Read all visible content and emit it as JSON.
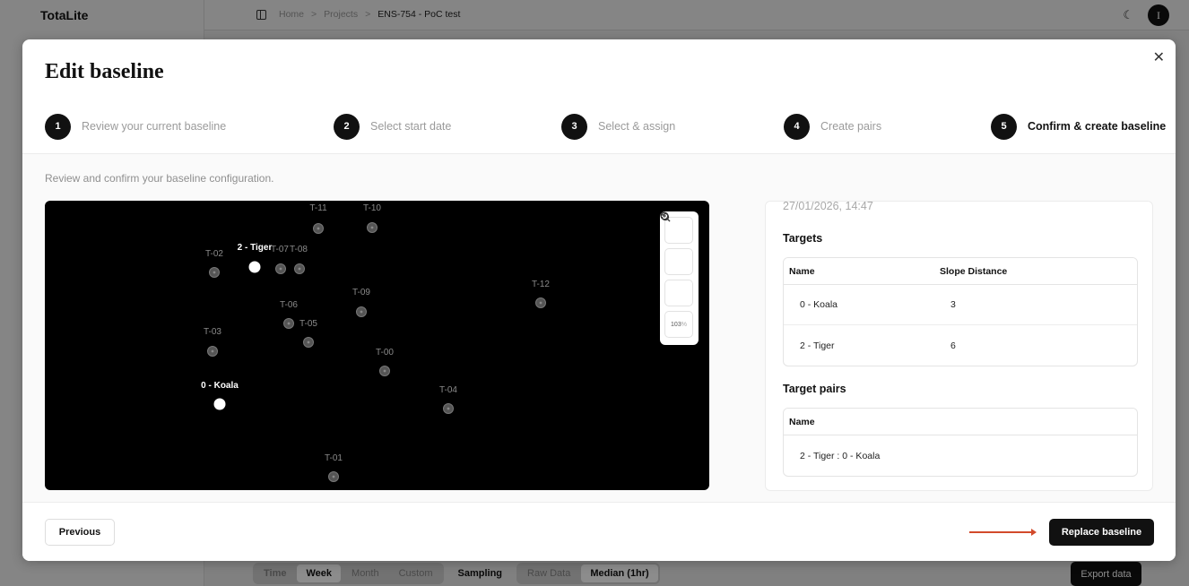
{
  "app": {
    "brand": "TotaLite",
    "breadcrumb": [
      "Home",
      "Projects",
      "ENS-754 - PoC test"
    ],
    "breadcrumb_sep": ">",
    "avatar_initial": "I",
    "bottom_bar": {
      "time_label": "Time",
      "time_options": [
        "Week",
        "Month",
        "Custom"
      ],
      "time_selected": "Week",
      "sampling_label": "Sampling",
      "sampling_options": [
        "Raw Data",
        "Median (1hr)"
      ],
      "sampling_selected": "Median (1hr)",
      "export_label": "Export data"
    }
  },
  "modal": {
    "title": "Edit baseline",
    "close_icon": "close-icon",
    "steps": [
      {
        "num": "1",
        "label": "Review your current baseline",
        "active": false
      },
      {
        "num": "2",
        "label": "Select start date",
        "active": false
      },
      {
        "num": "3",
        "label": "Select & assign",
        "active": false
      },
      {
        "num": "4",
        "label": "Create pairs",
        "active": false
      },
      {
        "num": "5",
        "label": "Confirm & create baseline",
        "active": true
      }
    ],
    "hint": "Review and confirm your baseline configuration.",
    "map": {
      "zoom_pct": "103",
      "zoom_unit": "%",
      "points": [
        {
          "label": "T-11",
          "selected": false
        },
        {
          "label": "T-10",
          "selected": false
        },
        {
          "label": "T-02",
          "selected": false
        },
        {
          "label": "2 - Tiger",
          "selected": true
        },
        {
          "label": "T-07",
          "selected": false
        },
        {
          "label": "T-08",
          "selected": false
        },
        {
          "label": "T-09",
          "selected": false
        },
        {
          "label": "T-12",
          "selected": false
        },
        {
          "label": "T-06",
          "selected": false
        },
        {
          "label": "T-05",
          "selected": false
        },
        {
          "label": "T-03",
          "selected": false
        },
        {
          "label": "T-00",
          "selected": false
        },
        {
          "label": "0 - Koala",
          "selected": true
        },
        {
          "label": "T-04",
          "selected": false
        },
        {
          "label": "T-01",
          "selected": false
        }
      ]
    },
    "summary": {
      "timestamp": "27/01/2026, 14:47",
      "targets_title": "Targets",
      "targets_headers": [
        "Name",
        "Slope Distance"
      ],
      "targets_rows": [
        {
          "name": "0 - Koala",
          "slope": "3"
        },
        {
          "name": "2 - Tiger",
          "slope": "6"
        }
      ],
      "pairs_title": "Target pairs",
      "pairs_header": "Name",
      "pairs_rows": [
        "2 - Tiger : 0 - Koala"
      ]
    },
    "footer": {
      "previous_label": "Previous",
      "replace_label": "Replace baseline",
      "arrow_color": "#d24a2b"
    }
  }
}
